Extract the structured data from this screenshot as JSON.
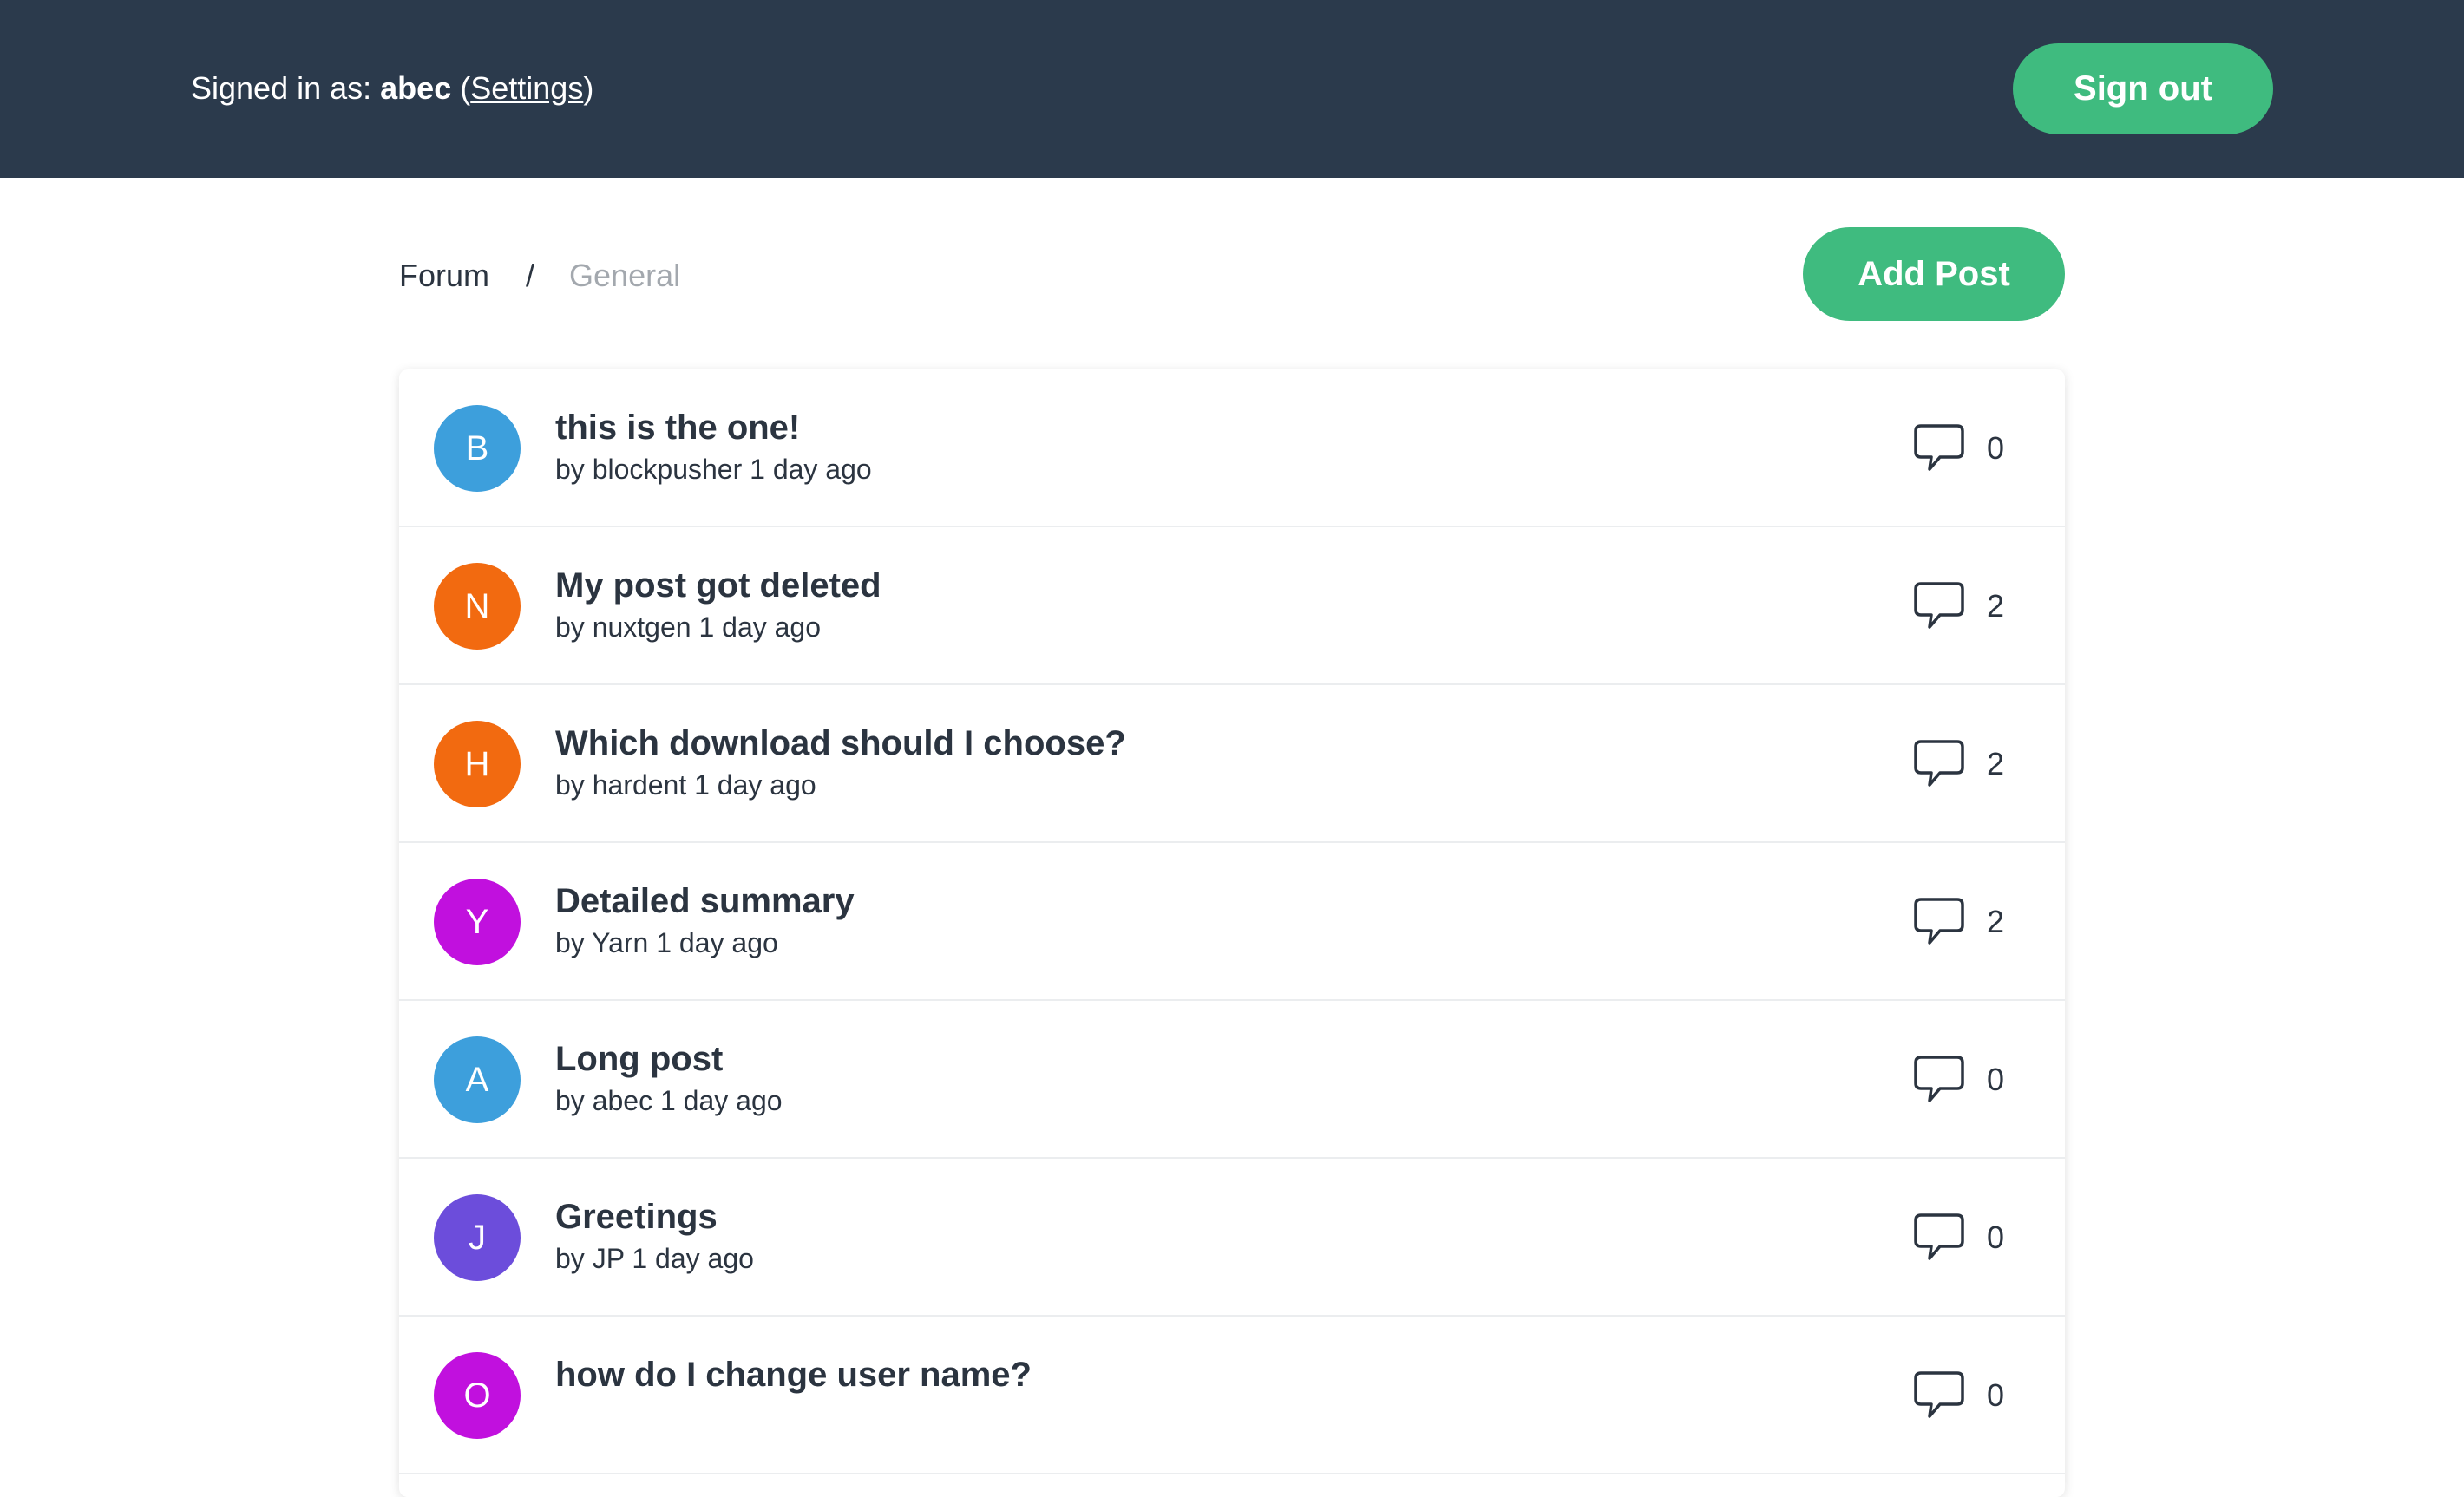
{
  "header": {
    "signed_in_prefix": "Signed in as: ",
    "username": "abec",
    "settings_open": "(",
    "settings_label": "Settings",
    "settings_close": ")",
    "sign_out_label": "Sign out"
  },
  "breadcrumb": {
    "forum": "Forum",
    "separator": "/",
    "current": "General"
  },
  "add_post_label": "Add Post",
  "colors": {
    "topbar": "#2b3a4c",
    "accent": "#3fbb7f",
    "text": "#2b3440",
    "muted": "#a3a8ae"
  },
  "posts": [
    {
      "initial": "B",
      "avatar_color": "#3d9fdc",
      "title": "this is the one!",
      "meta": "by blockpusher 1 day ago",
      "comments": "0",
      "icon": "comment-icon"
    },
    {
      "initial": "N",
      "avatar_color": "#f26a10",
      "title": "My post got deleted",
      "meta": "by nuxtgen 1 day ago",
      "comments": "2",
      "icon": "comment-icon"
    },
    {
      "initial": "H",
      "avatar_color": "#f26a10",
      "title": "Which download should I choose?",
      "meta": "by hardent 1 day ago",
      "comments": "2",
      "icon": "comment-icon"
    },
    {
      "initial": "Y",
      "avatar_color": "#c110de",
      "title": "Detailed summary",
      "meta": "by Yarn 1 day ago",
      "comments": "2",
      "icon": "comment-icon"
    },
    {
      "initial": "A",
      "avatar_color": "#3d9fdc",
      "title": "Long post",
      "meta": "by abec 1 day ago",
      "comments": "0",
      "icon": "comment-icon"
    },
    {
      "initial": "J",
      "avatar_color": "#6c4ddb",
      "title": "Greetings",
      "meta": "by JP 1 day ago",
      "comments": "0",
      "icon": "comment-icon"
    },
    {
      "initial": "O",
      "avatar_color": "#c110de",
      "title": "how do I change user name?",
      "meta": "",
      "comments": "0",
      "icon": "comment-icon"
    }
  ]
}
